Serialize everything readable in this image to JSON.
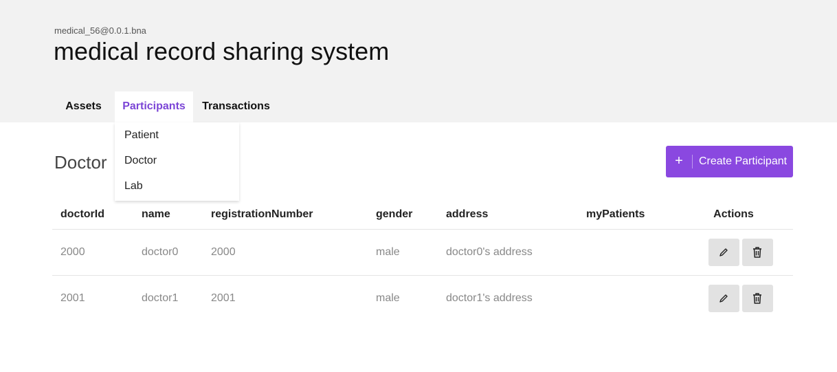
{
  "header": {
    "app_id": "medical_56@0.0.1.bna",
    "title": "medical record sharing system"
  },
  "tabs": [
    {
      "label": "Assets",
      "active": false
    },
    {
      "label": "Participants",
      "active": true
    },
    {
      "label": "Transactions",
      "active": false
    }
  ],
  "dropdown": {
    "items": [
      "Patient",
      "Doctor",
      "Lab"
    ]
  },
  "main": {
    "section_title": "Doctor",
    "create_button": {
      "icon": "plus-icon",
      "label": "Create Participant"
    }
  },
  "table": {
    "columns": [
      "doctorId",
      "name",
      "registrationNumber",
      "gender",
      "address",
      "myPatients",
      "Actions"
    ],
    "rows": [
      {
        "doctorId": "2000",
        "name": "doctor0",
        "registrationNumber": "2000",
        "gender": "male",
        "address": "doctor0's address",
        "myPatients": ""
      },
      {
        "doctorId": "2001",
        "name": "doctor1",
        "registrationNumber": "2001",
        "gender": "male",
        "address": "doctor1's address",
        "myPatients": ""
      }
    ]
  },
  "colors": {
    "accent": "#8a48e0",
    "active_tab": "#7b45d6",
    "header_bg": "#f2f2f2"
  }
}
